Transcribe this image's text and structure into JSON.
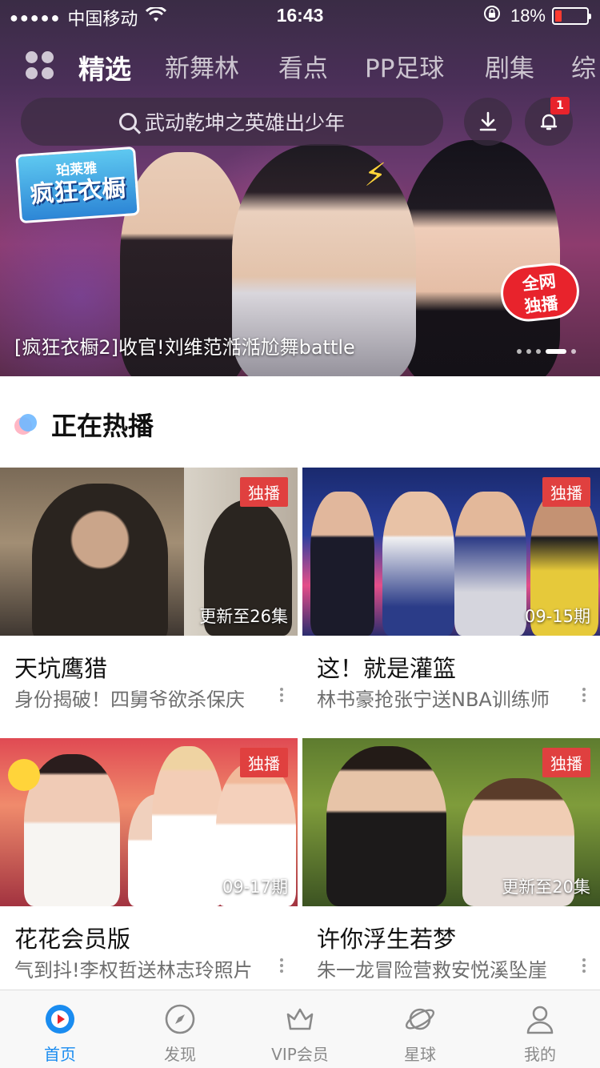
{
  "status_bar": {
    "signal": "●●●●●",
    "carrier": "中国移动",
    "time": "16:43",
    "battery_percent": "18%",
    "battery_level": 0.18,
    "colors": {
      "battery_low": "#ff3b30"
    }
  },
  "header": {
    "tabs": [
      {
        "label": "精选",
        "active": true
      },
      {
        "label": "新舞林",
        "active": false
      },
      {
        "label": "看点",
        "active": false
      },
      {
        "label": "PP足球",
        "active": false
      },
      {
        "label": "剧集",
        "active": false
      },
      {
        "label": "综",
        "active": false
      }
    ],
    "search_placeholder": "武动乾坤之英雄出少年",
    "notification_count": "1"
  },
  "hero": {
    "show_logo_line1": "珀莱雅",
    "show_logo_line2": "疯狂衣橱",
    "exclusive_badge_line1": "全网",
    "exclusive_badge_line2": "独播",
    "caption": "[疯狂衣橱2]收官!刘维范湉湉尬舞battle",
    "pager": {
      "count": 5,
      "active_index": 3
    }
  },
  "section": {
    "title": "正在热播"
  },
  "cards": [
    {
      "badge": "独播",
      "episode": "更新至26集",
      "title": "天坑鹰猎",
      "subtitle": "身份揭破！四舅爷欲杀保庆"
    },
    {
      "badge": "独播",
      "episode": "09-15期",
      "title": "这！就是灌篮",
      "subtitle": "林书豪抢张宁送NBA训练师"
    },
    {
      "badge": "独播",
      "episode": "09-17期",
      "title": "花花会员版",
      "subtitle": "气到抖!李权哲送林志玲照片"
    },
    {
      "badge": "独播",
      "episode": "更新至20集",
      "title": "许你浮生若梦",
      "subtitle": "朱一龙冒险营救安悦溪坠崖"
    }
  ],
  "bottom_nav": [
    {
      "label": "首页",
      "icon": "home-play-icon",
      "active": true
    },
    {
      "label": "发现",
      "icon": "compass-icon",
      "active": false
    },
    {
      "label": "VIP会员",
      "icon": "crown-icon",
      "active": false
    },
    {
      "label": "星球",
      "icon": "planet-icon",
      "active": false
    },
    {
      "label": "我的",
      "icon": "person-icon",
      "active": false
    }
  ],
  "colors": {
    "accent": "#1a8cf0",
    "badge_red": "#e0403f"
  }
}
